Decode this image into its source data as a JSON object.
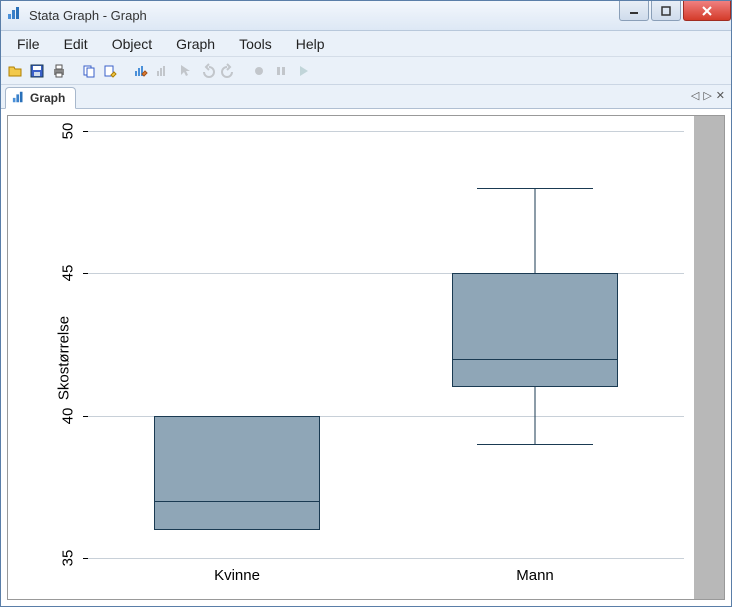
{
  "window": {
    "title": "Stata Graph - Graph"
  },
  "menu": {
    "items": [
      "File",
      "Edit",
      "Object",
      "Graph",
      "Tools",
      "Help"
    ]
  },
  "tab": {
    "label": "Graph"
  },
  "chart_data": {
    "type": "boxplot",
    "ylabel": "Skostørrelse",
    "ylim": [
      35,
      50
    ],
    "yticks": [
      35,
      40,
      45,
      50
    ],
    "categories": [
      "Kvinne",
      "Mann"
    ],
    "series": [
      {
        "name": "Kvinne",
        "min": 36,
        "q1": 36,
        "median": 37,
        "q3": 40,
        "max": 40
      },
      {
        "name": "Mann",
        "min": 39,
        "q1": 41,
        "median": 42,
        "q3": 45,
        "max": 48
      }
    ]
  },
  "icons": {
    "app": "bar-chart-icon"
  }
}
